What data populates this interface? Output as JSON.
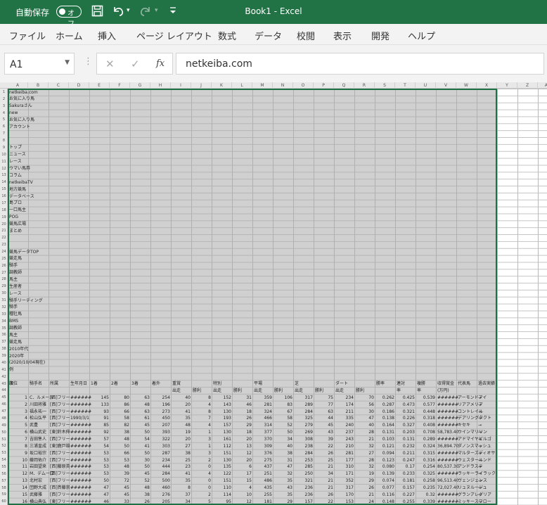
{
  "titlebar": {
    "autosave_label": "自動保存",
    "autosave_state": "オフ",
    "title": "Book1  -  Excel",
    "qa_icons": [
      "save-icon",
      "undo-icon",
      "redo-icon",
      "customize-icon"
    ]
  },
  "menu": [
    "ファイル",
    "ホーム",
    "挿入",
    "ページ レイアウト",
    "数式",
    "データ",
    "校閲",
    "表示",
    "開発",
    "ヘルプ"
  ],
  "formula": {
    "namebox": "A1",
    "cancel": "✕",
    "enter": "✓",
    "fx": "fx",
    "value": "netkeiba.com"
  },
  "columns": [
    "A",
    "B",
    "C",
    "D",
    "E",
    "F",
    "G",
    "H",
    "I",
    "J",
    "K",
    "L",
    "M",
    "N",
    "O",
    "P",
    "Q",
    "R",
    "S",
    "T",
    "U",
    "V",
    "W",
    "X",
    "Y",
    "Z",
    "AA"
  ],
  "rows": [
    "1",
    "2",
    "3",
    "4",
    "5",
    "6",
    "7",
    "8",
    "9",
    "10",
    "11",
    "12",
    "13",
    "14",
    "15",
    "16",
    "17",
    "18",
    "19",
    "20",
    "21",
    "22",
    "23",
    "24",
    "25",
    "26",
    "27",
    "28",
    "29",
    "30",
    "31",
    "32",
    "33",
    "34",
    "35",
    "36",
    "37",
    "38",
    "39",
    "40",
    "41",
    "42",
    "43",
    "44",
    "45",
    "46",
    "47",
    "48",
    "49",
    "50",
    "51",
    "52",
    "53",
    "54",
    "55",
    "56",
    "57",
    "58",
    "59",
    "60"
  ],
  "sheet": {
    "colA_text": [
      "netkeiba.com",
      "お気に入り馬",
      "Sakuraさん",
      "new",
      "お気に入り馬",
      "アカウント",
      "",
      "",
      "トップ",
      "ニュース",
      "レース",
      "ウマい馬券",
      "コラム",
      "netkeibaTV",
      "地方競馬",
      "データベース",
      "島プロ",
      "一口馬主",
      "POG",
      "競馬広場",
      "まとめ",
      "",
      "",
      "競馬データTOP",
      "競走馬",
      "騎手",
      "調教師",
      "馬主",
      "生産者",
      "レース",
      "騎手リーディング",
      "騎手",
      "種牡馬",
      "BMS",
      "調教師",
      "馬主",
      "競走馬",
      "2010年代",
      "2020年",
      "(2020/10/04現在)",
      "例",
      "",
      "次",
      "順位"
    ],
    "header_row": [
      "順位",
      "騎手名",
      "所属",
      "生年月日",
      "1着",
      "2着",
      "3着",
      "着外",
      "重賞",
      "",
      "特別",
      "",
      "平場",
      "",
      "芝",
      "",
      "ダート",
      "",
      "勝率",
      "連対",
      "複勝",
      "収得賞金",
      "代表馬",
      "過去実績"
    ],
    "subheader_row": [
      "",
      "",
      "",
      "",
      "",
      "",
      "",
      "",
      "出走",
      "勝利",
      "出走",
      "勝利",
      "出走",
      "勝利",
      "出走",
      "勝利",
      "出走",
      "勝利",
      "",
      "率",
      "率",
      "(万円)",
      "",
      ""
    ],
    "table": [
      [
        "1",
        "C．ルメール",
        "[西]フリー",
        "######",
        "145",
        "80",
        "63",
        "254",
        "40",
        "8",
        "152",
        "31",
        "359",
        "106",
        "317",
        "75",
        "234",
        "70",
        "0.262",
        "0.425",
        "0.539",
        "######",
        "アーモンドアイ",
        "→"
      ],
      [
        "2",
        "川田将雅",
        "[西]フリー",
        "######",
        "133",
        "86",
        "48",
        "196",
        "20",
        "4",
        "143",
        "46",
        "281",
        "83",
        "289",
        "77",
        "174",
        "56",
        "0.287",
        "0.473",
        "0.577",
        "######",
        "リアアメリア",
        "→"
      ],
      [
        "3",
        "福永祐一",
        "[西]フリー",
        "######",
        "93",
        "66",
        "63",
        "273",
        "41",
        "8",
        "130",
        "18",
        "324",
        "67",
        "284",
        "63",
        "211",
        "30",
        "0.186",
        "0.321",
        "0.448",
        "######",
        "コントレイル",
        "→"
      ],
      [
        "4",
        "松山弘平",
        "[西]フリー",
        "1990/3/1",
        "91",
        "58",
        "61",
        "450",
        "35",
        "7",
        "193",
        "26",
        "466",
        "58",
        "325",
        "44",
        "335",
        "47",
        "0.138",
        "0.226",
        "0.318",
        "######",
        "デアリングタクト",
        "→"
      ],
      [
        "5",
        "武豊",
        "[西]フリー",
        "######",
        "85",
        "82",
        "45",
        "207",
        "48",
        "4",
        "157",
        "29",
        "314",
        "52",
        "279",
        "45",
        "240",
        "40",
        "0.164",
        "0.327",
        "0.408",
        "######",
        "キセキ",
        "→"
      ],
      [
        "6",
        "横山武史",
        "[東]鈴木伸",
        "######",
        "92",
        "38",
        "50",
        "393",
        "19",
        "1",
        "130",
        "18",
        "377",
        "50",
        "269",
        "43",
        "237",
        "28",
        "0.131",
        "0.203",
        "0.708",
        "58,783.40",
        "ウインマリリン",
        "→"
      ],
      [
        "7",
        "吉田隼人",
        "[西]フリー",
        "######",
        "57",
        "48",
        "54",
        "322",
        "20",
        "3",
        "161",
        "20",
        "370",
        "34",
        "308",
        "39",
        "243",
        "21",
        "0.103",
        "0.131",
        "0.289",
        "######",
        "アドマイヤビルゴ",
        "→"
      ],
      [
        "8",
        "三浦皇成",
        "[東]鹿戸雄",
        "######",
        "54",
        "50",
        "41",
        "303",
        "27",
        "1",
        "112",
        "13",
        "309",
        "40",
        "238",
        "22",
        "210",
        "32",
        "0.121",
        "0.232",
        "0.324",
        "36,894.70",
        "ダノンスマッシュ",
        "→"
      ],
      [
        "9",
        "坂口裕宗",
        "[西]フリー",
        "######",
        "53",
        "66",
        "50",
        "287",
        "38",
        "3",
        "151",
        "12",
        "376",
        "38",
        "284",
        "26",
        "281",
        "27",
        "0.094",
        "0.211",
        "0.315",
        "######",
        "マルターズディオサ",
        "→"
      ],
      [
        "10",
        "藤岡佑介",
        "[西]フリー",
        "######",
        "53",
        "53",
        "30",
        "234",
        "25",
        "2",
        "130",
        "20",
        "275",
        "31",
        "253",
        "25",
        "177",
        "28",
        "0.123",
        "0.247",
        "0.316",
        "######",
        "ウェスタールンド",
        "→"
      ],
      [
        "11",
        "岩田望来",
        "[西]藤原英",
        "######",
        "53",
        "48",
        "50",
        "444",
        "23",
        "0",
        "135",
        "6",
        "437",
        "47",
        "285",
        "21",
        "310",
        "32",
        "0.080",
        "0.17",
        "0.254",
        "80,537.30",
        "アンドラステ",
        "→"
      ],
      [
        "12",
        "M．デムーロ",
        "[西]フリー",
        "######",
        "53",
        "39",
        "45",
        "284",
        "41",
        "4",
        "122",
        "17",
        "251",
        "32",
        "250",
        "34",
        "171",
        "19",
        "0.139",
        "0.233",
        "0.325",
        "######",
        "ラッキーライラック",
        "→"
      ],
      [
        "13",
        "北村宏",
        "[西]フリー",
        "######",
        "50",
        "72",
        "52",
        "500",
        "35",
        "0",
        "151",
        "15",
        "486",
        "35",
        "321",
        "21",
        "352",
        "29",
        "0.074",
        "0.181",
        "0.258",
        "96,513.40",
        "ヴェンジェンス",
        "→"
      ],
      [
        "14",
        "団野大成",
        "[西]斉藤崇",
        "######",
        "47",
        "45",
        "48",
        "460",
        "8",
        "0",
        "110",
        "4",
        "435",
        "43",
        "236",
        "21",
        "317",
        "26",
        "0.077",
        "0.157",
        "0.235",
        "72,027.40",
        "リュヌルージュ",
        "→"
      ],
      [
        "15",
        "武藤雅",
        "[西]フリー",
        "######",
        "47",
        "45",
        "38",
        "276",
        "37",
        "2",
        "114",
        "10",
        "255",
        "35",
        "236",
        "26",
        "170",
        "21",
        "0.116",
        "0.227",
        "0.32",
        "######",
        "グランアレグリア",
        "→"
      ],
      [
        "16",
        "横山典弘",
        "[東]フリー",
        "######",
        "46",
        "33",
        "26",
        "205",
        "34",
        "5",
        "95",
        "12",
        "181",
        "29",
        "157",
        "22",
        "153",
        "24",
        "0.148",
        "0.255",
        "0.339",
        "######",
        "ミッキースワロー",
        "→"
      ]
    ]
  }
}
